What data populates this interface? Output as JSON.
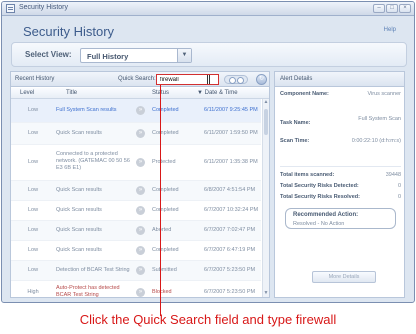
{
  "window": {
    "title": "Security History",
    "controls": [
      "–",
      "□",
      "×"
    ]
  },
  "header": {
    "title": "Security History",
    "help": "Help"
  },
  "view": {
    "label": "Select View:",
    "value": "Full History"
  },
  "history": {
    "title": "Recent History",
    "quick_search_label": "Quick Search:",
    "quick_search_value": "firewall",
    "columns": [
      "Level",
      "Title",
      "Status",
      "▼ Date & Time"
    ],
    "rows": [
      {
        "level": "Low",
        "title": "Full System Scan results",
        "status": "Completed",
        "date": "6/11/2007 9:25:45 PM"
      },
      {
        "level": "Low",
        "title": "Quick Scan results",
        "status": "Completed",
        "date": "6/11/2007 1:59:50 PM"
      },
      {
        "level": "Low",
        "title": "Connected to a protected network. (GATEMAC 00 50 56 E3 6B E1)",
        "status": "Protected",
        "date": "6/11/2007 1:35:38 PM"
      },
      {
        "level": "Low",
        "title": "Quick Scan results",
        "status": "Completed",
        "date": "6/8/2007 4:51:54 PM"
      },
      {
        "level": "Low",
        "title": "Quick Scan results",
        "status": "Completed",
        "date": "6/7/2007 10:32:24 PM"
      },
      {
        "level": "Low",
        "title": "Quick Scan results",
        "status": "Aborted",
        "date": "6/7/2007 7:02:47 PM"
      },
      {
        "level": "Low",
        "title": "Quick Scan results",
        "status": "Completed",
        "date": "6/7/2007 6:47:19 PM"
      },
      {
        "level": "Low",
        "title": "Detection of BCAR Test String",
        "status": "Submitted",
        "date": "6/7/2007 5:23:50 PM"
      },
      {
        "level": "High",
        "title": "Auto-Protect has detected BCAR Test String",
        "status": "Blocked",
        "date": "6/7/2007 5:23:50 PM"
      }
    ]
  },
  "alert": {
    "title": "Alert Details",
    "component_label": "Component Name:",
    "component_value": "Virus scanner",
    "task_label": "Task Name:",
    "task_value": "Full System Scan",
    "scan_time_label": "Scan Time:",
    "scan_time_value": "0:00:22:10 (d:h:m:s)",
    "items_label": "Total items scanned:",
    "items_value": "39448",
    "detected_label": "Total Security Risks Detected:",
    "detected_value": "0",
    "resolved_label": "Total Security Risks Resolved:",
    "resolved_value": "0",
    "recommended_label": "Recommended Action:",
    "recommended_value": "Resolved - No Action",
    "more_details": "More Details"
  },
  "instruction": "Click the Quick Search field and type firewall",
  "colors": {
    "accent": "#3d5c8c",
    "highlight": "#d81818",
    "link": "#3d6fcf"
  },
  "icons": [
    "app-icon",
    "dropdown-arrow-icon",
    "search-toggle-icon",
    "refresh-icon",
    "info-icon",
    "scroll-arrow-icon"
  ]
}
